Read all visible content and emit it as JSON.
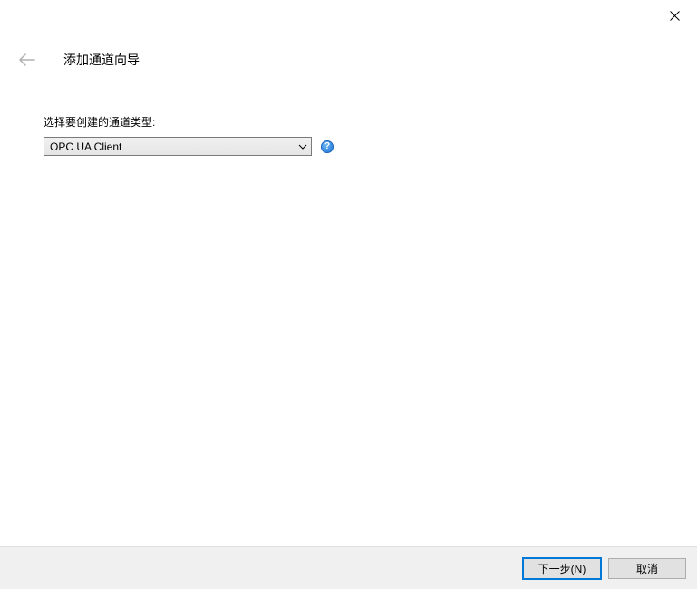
{
  "header": {
    "title": "添加通道向导"
  },
  "content": {
    "prompt": "选择要创建的通道类型:",
    "dropdown_selected": "OPC UA Client",
    "help_glyph": "?"
  },
  "footer": {
    "next_label": "下一步(N)",
    "cancel_label": "取消"
  }
}
